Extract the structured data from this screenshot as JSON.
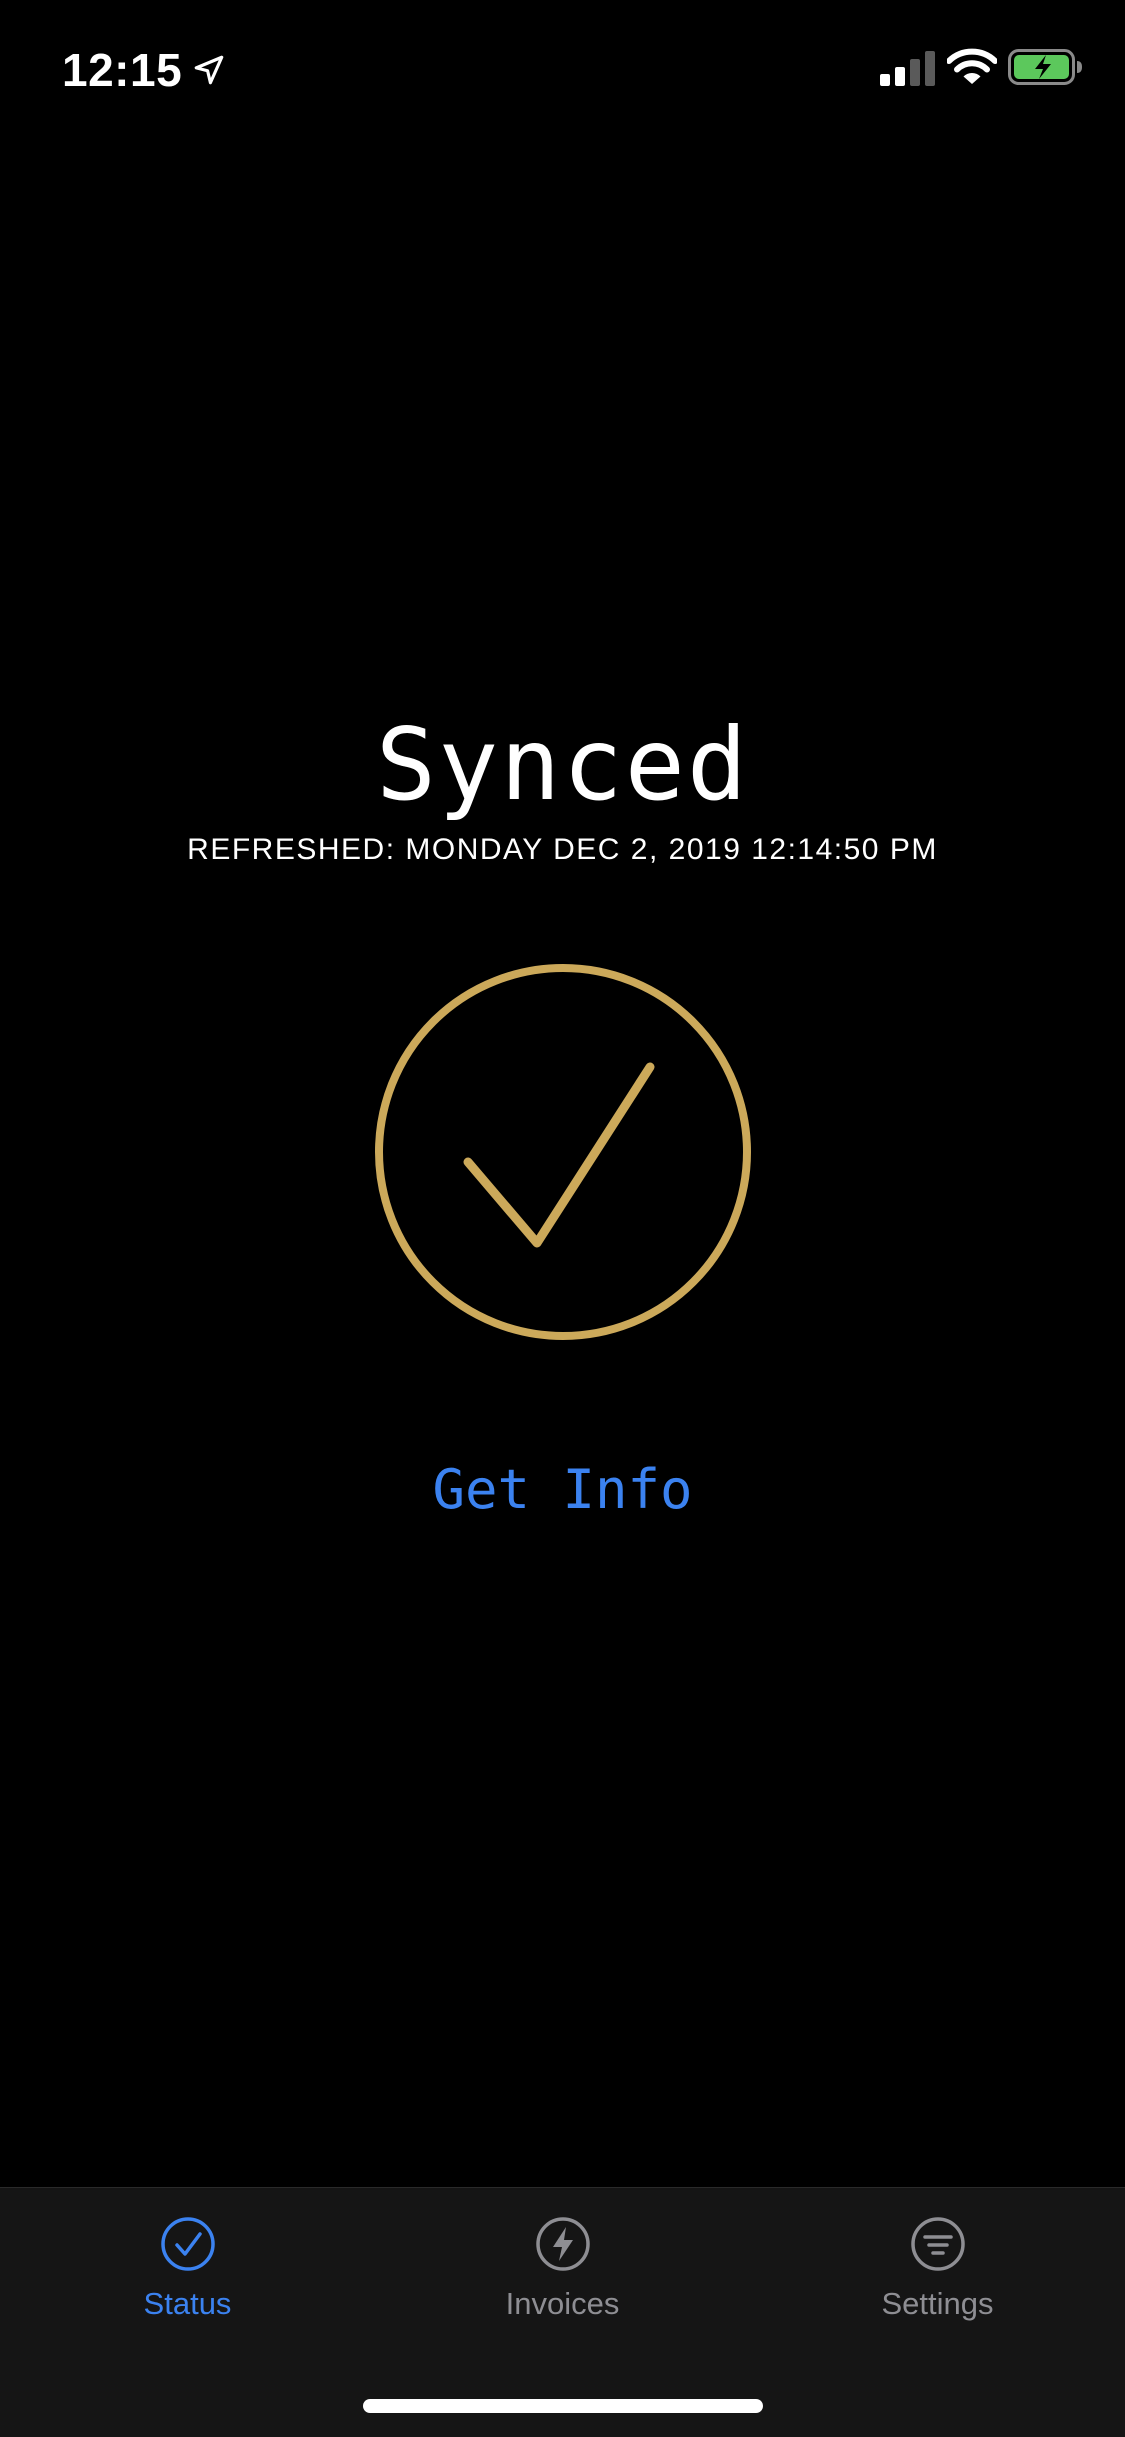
{
  "status_bar": {
    "time": "12:15",
    "location_icon": "location-arrow-icon",
    "signal_icon": "cellular-signal-icon",
    "wifi_icon": "wifi-icon",
    "battery_icon": "battery-charging-icon",
    "battery_color": "#5cc85c"
  },
  "main": {
    "title": "Synced",
    "refreshed": "REFRESHED: MONDAY DEC 2, 2019 12:14:50 PM",
    "status_icon": "checkmark-circle-icon",
    "accent_gold": "#cca95a",
    "get_info_label": "Get Info",
    "link_color": "#3b82f0"
  },
  "tab_bar": {
    "tabs": [
      {
        "label": "Status",
        "icon": "check-circle-icon",
        "active": true,
        "color": "#3b82f0"
      },
      {
        "label": "Invoices",
        "icon": "lightning-circle-icon",
        "active": false,
        "color": "#8e8e93"
      },
      {
        "label": "Settings",
        "icon": "filter-circle-icon",
        "active": false,
        "color": "#8e8e93"
      }
    ]
  }
}
